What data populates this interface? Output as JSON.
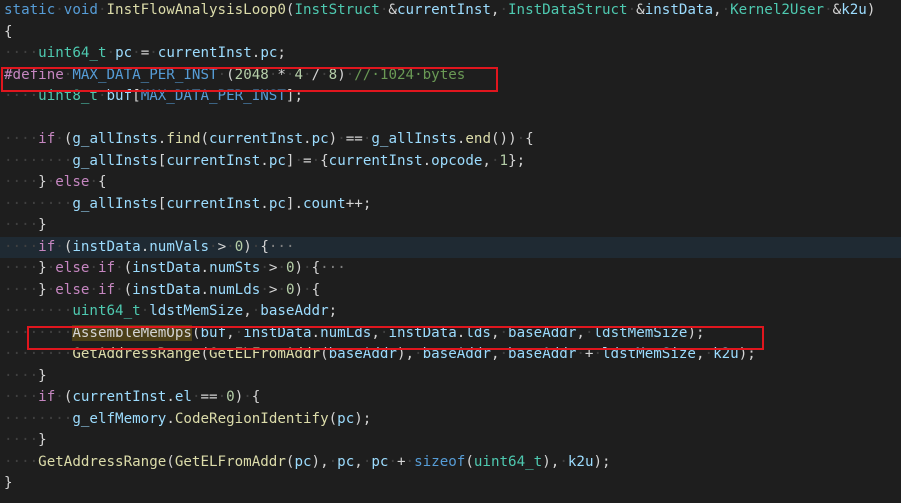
{
  "editor": {
    "theme": {
      "background": "#1e1e1e",
      "highlight_line": "#1f2a33",
      "box_color": "#e0161e"
    },
    "lines": [
      [
        [
          "kw",
          "static"
        ],
        [
          "ws",
          "·"
        ],
        [
          "kw",
          "void"
        ],
        [
          "ws",
          "·"
        ],
        [
          "fn",
          "InstFlowAnalysisLoop0"
        ],
        [
          "pl",
          "("
        ],
        [
          "ty",
          "InstStruct"
        ],
        [
          "ws",
          "·"
        ],
        [
          "pl",
          "&"
        ],
        [
          "vr",
          "currentInst"
        ],
        [
          "pl",
          ","
        ],
        [
          "ws",
          "·"
        ],
        [
          "ty",
          "InstDataStruct"
        ],
        [
          "ws",
          "·"
        ],
        [
          "pl",
          "&"
        ],
        [
          "vr",
          "instData"
        ],
        [
          "pl",
          ","
        ],
        [
          "ws",
          "·"
        ],
        [
          "ty",
          "Kernel2User"
        ],
        [
          "ws",
          "·"
        ],
        [
          "pl",
          "&"
        ],
        [
          "vr",
          "k2u"
        ],
        [
          "pl",
          ")"
        ]
      ],
      [
        [
          "pl",
          "{"
        ]
      ],
      [
        [
          "ws",
          "····"
        ],
        [
          "ty",
          "uint64_t"
        ],
        [
          "ws",
          "·"
        ],
        [
          "vr",
          "pc"
        ],
        [
          "ws",
          "·"
        ],
        [
          "pl",
          "="
        ],
        [
          "ws",
          "·"
        ],
        [
          "vr",
          "currentInst"
        ],
        [
          "pl",
          "."
        ],
        [
          "vr",
          "pc"
        ],
        [
          "pl",
          ";"
        ]
      ],
      [
        [
          "pp",
          "#define"
        ],
        [
          "ws",
          "·"
        ],
        [
          "mac",
          "MAX_DATA_PER_INST"
        ],
        [
          "ws",
          "·"
        ],
        [
          "pl",
          "("
        ],
        [
          "num",
          "2048"
        ],
        [
          "ws",
          "·"
        ],
        [
          "pl",
          "*"
        ],
        [
          "ws",
          "·"
        ],
        [
          "num",
          "4"
        ],
        [
          "ws",
          "·"
        ],
        [
          "pl",
          "/"
        ],
        [
          "ws",
          "·"
        ],
        [
          "num",
          "8"
        ],
        [
          "pl",
          ")"
        ],
        [
          "ws",
          "·"
        ],
        [
          "cm",
          "//·1024·bytes"
        ]
      ],
      [
        [
          "ws",
          "····"
        ],
        [
          "ty",
          "uint8_t"
        ],
        [
          "ws",
          "·"
        ],
        [
          "vr",
          "buf"
        ],
        [
          "pl",
          "["
        ],
        [
          "mac",
          "MAX_DATA_PER_INST"
        ],
        [
          "pl",
          "];"
        ]
      ],
      [],
      [
        [
          "ws",
          "····"
        ],
        [
          "ctl",
          "if"
        ],
        [
          "ws",
          "·"
        ],
        [
          "pl",
          "("
        ],
        [
          "vr",
          "g_allInsts"
        ],
        [
          "pl",
          "."
        ],
        [
          "fn",
          "find"
        ],
        [
          "pl",
          "("
        ],
        [
          "vr",
          "currentInst"
        ],
        [
          "pl",
          "."
        ],
        [
          "vr",
          "pc"
        ],
        [
          "pl",
          ")"
        ],
        [
          "ws",
          "·"
        ],
        [
          "pl",
          "=="
        ],
        [
          "ws",
          "·"
        ],
        [
          "vr",
          "g_allInsts"
        ],
        [
          "pl",
          "."
        ],
        [
          "fn",
          "end"
        ],
        [
          "pl",
          "())"
        ],
        [
          "ws",
          "·"
        ],
        [
          "pl",
          "{"
        ]
      ],
      [
        [
          "ws",
          "········"
        ],
        [
          "vr",
          "g_allInsts"
        ],
        [
          "pl",
          "["
        ],
        [
          "vr",
          "currentInst"
        ],
        [
          "pl",
          "."
        ],
        [
          "vr",
          "pc"
        ],
        [
          "pl",
          "]"
        ],
        [
          "ws",
          "·"
        ],
        [
          "pl",
          "="
        ],
        [
          "ws",
          "·"
        ],
        [
          "pl",
          "{"
        ],
        [
          "vr",
          "currentInst"
        ],
        [
          "pl",
          "."
        ],
        [
          "vr",
          "opcode"
        ],
        [
          "pl",
          ","
        ],
        [
          "ws",
          "·"
        ],
        [
          "num",
          "1"
        ],
        [
          "pl",
          "};"
        ]
      ],
      [
        [
          "ws",
          "····"
        ],
        [
          "pl",
          "}"
        ],
        [
          "ws",
          "·"
        ],
        [
          "ctl",
          "else"
        ],
        [
          "ws",
          "·"
        ],
        [
          "pl",
          "{"
        ]
      ],
      [
        [
          "ws",
          "········"
        ],
        [
          "vr",
          "g_allInsts"
        ],
        [
          "pl",
          "["
        ],
        [
          "vr",
          "currentInst"
        ],
        [
          "pl",
          "."
        ],
        [
          "vr",
          "pc"
        ],
        [
          "pl",
          "]."
        ],
        [
          "vr",
          "count"
        ],
        [
          "pl",
          "++;"
        ]
      ],
      [
        [
          "ws",
          "····"
        ],
        [
          "pl",
          "}"
        ]
      ],
      [
        [
          "ws",
          "····"
        ],
        [
          "ctl",
          "if"
        ],
        [
          "ws",
          "·"
        ],
        [
          "pl",
          "("
        ],
        [
          "vr",
          "instData"
        ],
        [
          "pl",
          "."
        ],
        [
          "vr",
          "numVals"
        ],
        [
          "ws",
          "·"
        ],
        [
          "pl",
          ">"
        ],
        [
          "ws",
          "·"
        ],
        [
          "num",
          "0"
        ],
        [
          "pl",
          ")"
        ],
        [
          "ws",
          "·"
        ],
        [
          "pl",
          "{"
        ],
        [
          "fold",
          "···"
        ]
      ],
      [
        [
          "ws",
          "····"
        ],
        [
          "pl",
          "}"
        ],
        [
          "ws",
          "·"
        ],
        [
          "ctl",
          "else"
        ],
        [
          "ws",
          "·"
        ],
        [
          "ctl",
          "if"
        ],
        [
          "ws",
          "·"
        ],
        [
          "pl",
          "("
        ],
        [
          "vr",
          "instData"
        ],
        [
          "pl",
          "."
        ],
        [
          "vr",
          "numSts"
        ],
        [
          "ws",
          "·"
        ],
        [
          "pl",
          ">"
        ],
        [
          "ws",
          "·"
        ],
        [
          "num",
          "0"
        ],
        [
          "pl",
          ")"
        ],
        [
          "ws",
          "·"
        ],
        [
          "pl",
          "{"
        ],
        [
          "fold",
          "···"
        ]
      ],
      [
        [
          "ws",
          "····"
        ],
        [
          "pl",
          "}"
        ],
        [
          "ws",
          "·"
        ],
        [
          "ctl",
          "else"
        ],
        [
          "ws",
          "·"
        ],
        [
          "ctl",
          "if"
        ],
        [
          "ws",
          "·"
        ],
        [
          "pl",
          "("
        ],
        [
          "vr",
          "instData"
        ],
        [
          "pl",
          "."
        ],
        [
          "vr",
          "numLds"
        ],
        [
          "ws",
          "·"
        ],
        [
          "pl",
          ">"
        ],
        [
          "ws",
          "·"
        ],
        [
          "num",
          "0"
        ],
        [
          "pl",
          ")"
        ],
        [
          "ws",
          "·"
        ],
        [
          "pl",
          "{"
        ]
      ],
      [
        [
          "ws",
          "········"
        ],
        [
          "ty",
          "uint64_t"
        ],
        [
          "ws",
          "·"
        ],
        [
          "vr",
          "ldstMemSize"
        ],
        [
          "pl",
          ","
        ],
        [
          "ws",
          "·"
        ],
        [
          "vr",
          "baseAddr"
        ],
        [
          "pl",
          ";"
        ]
      ],
      [
        [
          "ws",
          "········"
        ],
        [
          "fn-hl",
          "AssembleMemOps"
        ],
        [
          "pl",
          "("
        ],
        [
          "vr",
          "buf"
        ],
        [
          "pl",
          ","
        ],
        [
          "ws",
          "·"
        ],
        [
          "vr",
          "instData"
        ],
        [
          "pl",
          "."
        ],
        [
          "vr",
          "numLds"
        ],
        [
          "pl",
          ","
        ],
        [
          "ws",
          "·"
        ],
        [
          "vr",
          "instData"
        ],
        [
          "pl",
          "."
        ],
        [
          "vr",
          "lds"
        ],
        [
          "pl",
          ","
        ],
        [
          "ws",
          "·"
        ],
        [
          "vr",
          "baseAddr"
        ],
        [
          "pl",
          ","
        ],
        [
          "ws",
          "·"
        ],
        [
          "vr",
          "ldstMemSize"
        ],
        [
          "pl",
          ");"
        ]
      ],
      [
        [
          "ws",
          "········"
        ],
        [
          "fn",
          "GetAddressRange"
        ],
        [
          "pl",
          "("
        ],
        [
          "fn",
          "GetELFromAddr"
        ],
        [
          "pl",
          "("
        ],
        [
          "vr",
          "baseAddr"
        ],
        [
          "pl",
          "),"
        ],
        [
          "ws",
          "·"
        ],
        [
          "vr",
          "baseAddr"
        ],
        [
          "pl",
          ","
        ],
        [
          "ws",
          "·"
        ],
        [
          "vr",
          "baseAddr"
        ],
        [
          "ws",
          "·"
        ],
        [
          "pl",
          "+"
        ],
        [
          "ws",
          "·"
        ],
        [
          "vr",
          "ldstMemSize"
        ],
        [
          "pl",
          ","
        ],
        [
          "ws",
          "·"
        ],
        [
          "vr",
          "k2u"
        ],
        [
          "pl",
          ");"
        ]
      ],
      [
        [
          "ws",
          "····"
        ],
        [
          "pl",
          "}"
        ]
      ],
      [
        [
          "ws",
          "····"
        ],
        [
          "ctl",
          "if"
        ],
        [
          "ws",
          "·"
        ],
        [
          "pl",
          "("
        ],
        [
          "vr",
          "currentInst"
        ],
        [
          "pl",
          "."
        ],
        [
          "vr",
          "el"
        ],
        [
          "ws",
          "·"
        ],
        [
          "pl",
          "=="
        ],
        [
          "ws",
          "·"
        ],
        [
          "num",
          "0"
        ],
        [
          "pl",
          ")"
        ],
        [
          "ws",
          "·"
        ],
        [
          "pl",
          "{"
        ]
      ],
      [
        [
          "ws",
          "········"
        ],
        [
          "vr",
          "g_elfMemory"
        ],
        [
          "pl",
          "."
        ],
        [
          "fn",
          "CodeRegionIdentify"
        ],
        [
          "pl",
          "("
        ],
        [
          "vr",
          "pc"
        ],
        [
          "pl",
          ");"
        ]
      ],
      [
        [
          "ws",
          "····"
        ],
        [
          "pl",
          "}"
        ]
      ],
      [
        [
          "ws",
          "····"
        ],
        [
          "fn",
          "GetAddressRange"
        ],
        [
          "pl",
          "("
        ],
        [
          "fn",
          "GetELFromAddr"
        ],
        [
          "pl",
          "("
        ],
        [
          "vr",
          "pc"
        ],
        [
          "pl",
          "),"
        ],
        [
          "ws",
          "·"
        ],
        [
          "vr",
          "pc"
        ],
        [
          "pl",
          ","
        ],
        [
          "ws",
          "·"
        ],
        [
          "vr",
          "pc"
        ],
        [
          "ws",
          "·"
        ],
        [
          "pl",
          "+"
        ],
        [
          "ws",
          "·"
        ],
        [
          "kw",
          "sizeof"
        ],
        [
          "pl",
          "("
        ],
        [
          "ty",
          "uint64_t"
        ],
        [
          "pl",
          "),"
        ],
        [
          "ws",
          "·"
        ],
        [
          "vr",
          "k2u"
        ],
        [
          "pl",
          ");"
        ]
      ],
      [
        [
          "pl",
          "}"
        ]
      ]
    ],
    "highlighted_lines": [
      11
    ]
  }
}
